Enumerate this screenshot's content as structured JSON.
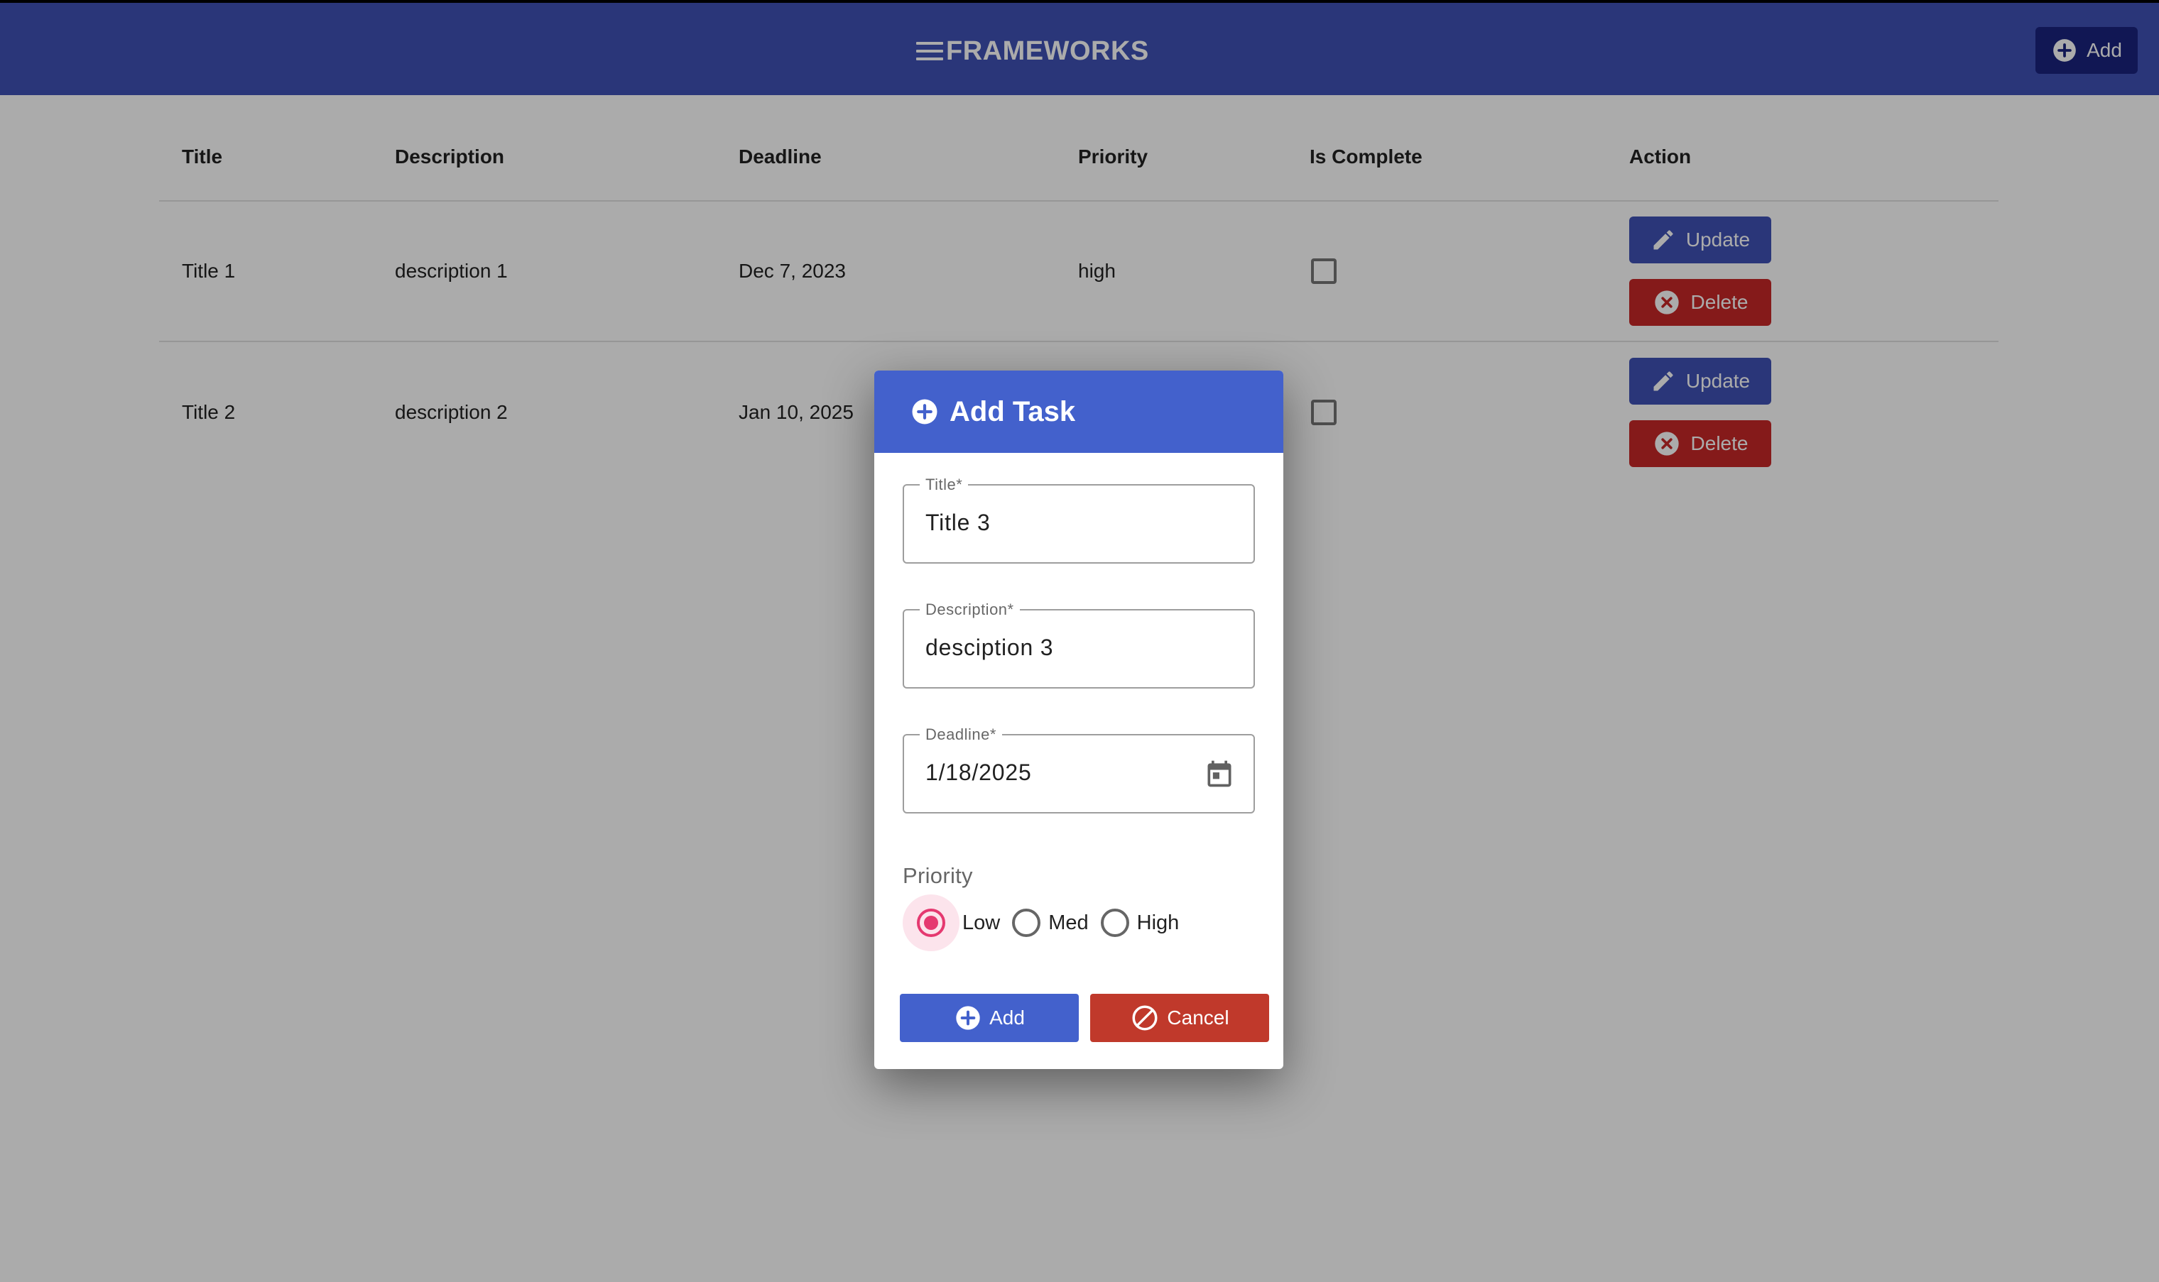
{
  "appbar": {
    "title": "FRAMEWORKS",
    "add_label": "Add"
  },
  "table": {
    "headers": [
      "Title",
      "Description",
      "Deadline",
      "Priority",
      "Is Complete",
      "Action"
    ],
    "rows": [
      {
        "title": "Title 1",
        "description": "description 1",
        "deadline": "Dec 7, 2023",
        "priority": "high",
        "is_complete": false
      },
      {
        "title": "Title 2",
        "description": "description 2",
        "deadline": "Jan 10, 2025",
        "priority": "",
        "is_complete": false
      }
    ],
    "update_label": "Update",
    "delete_label": "Delete"
  },
  "dialog": {
    "title": "Add Task",
    "fields": {
      "title": {
        "label": "Title*",
        "value": "Title 3"
      },
      "description": {
        "label": "Description*",
        "value": "desciption 3"
      },
      "deadline": {
        "label": "Deadline*",
        "value": "1/18/2025"
      }
    },
    "priority": {
      "label": "Priority",
      "options": [
        "Low",
        "Med",
        "High"
      ],
      "selected": "Low"
    },
    "add_label": "Add",
    "cancel_label": "Cancel"
  },
  "colors": {
    "primary": "#3f51b5",
    "appbar_add": "#1a237e",
    "delete": "#c62828",
    "radio_selected": "#e53970"
  }
}
